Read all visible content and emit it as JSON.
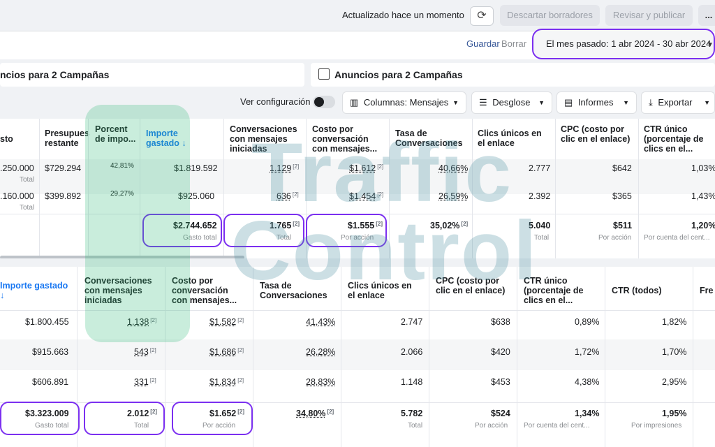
{
  "topbar": {
    "updated": "Actualizado hace un momento",
    "discard": "Descartar borradores",
    "review": "Revisar y publicar",
    "more": "..."
  },
  "bar2": {
    "save": "Guardar",
    "clear": "Borrar",
    "date_range": "El mes pasado: 1 abr 2024 - 30 abr 2024"
  },
  "tabs": {
    "left": "ncios para 2 Campañas",
    "right": "Anuncios para 2 Campañas"
  },
  "toolbar": {
    "config": "Ver configuración",
    "columns": "Columnas: Mensajes",
    "breakdown": "Desglose",
    "reports": "Informes",
    "export": "Exportar"
  },
  "table1": {
    "headers": [
      "sto",
      "Presupues restante",
      "Porcent de impo...",
      "Importe gastado ↓",
      "Conversaciones con mensajes iniciadas",
      "Costo por conversación con mensajes...",
      "Tasa de Conversaciones",
      "Clics únicos en el enlace",
      "CPC (costo por clic en el enlace)",
      "CTR único (porcentaje de clics en el..."
    ],
    "rows": [
      {
        "c0": ".250.000",
        "c0sub": "Total",
        "c1": "$729.294",
        "c2": "42,81%",
        "c3": "$1.819.592",
        "c4": "1.129",
        "c5": "$1.612",
        "c6": "40,66%",
        "c7": "2.777",
        "c8": "$642",
        "c9": "1,03%"
      },
      {
        "c0": ".160.000",
        "c0sub": "Total",
        "c1": "$399.892",
        "c2": "29,27%",
        "c3": "$925.060",
        "c4": "636",
        "c5": "$1.454",
        "c6": "26,59%",
        "c7": "2.392",
        "c8": "$365",
        "c9": "1,43%"
      }
    ],
    "total": {
      "c3": "$2.744.652",
      "c3sub": "Gasto total",
      "c4": "1.765",
      "c4sub": "Total",
      "c5": "$1.555",
      "c5sub": "Por acción",
      "c6": "35,02%",
      "c7": "5.040",
      "c7sub": "Total",
      "c8": "$511",
      "c8sub": "Por acción",
      "c9": "1,20%",
      "c9sub": "Por cuenta del cent..."
    }
  },
  "table2": {
    "headers": [
      "Importe gastado ↓",
      "Conversaciones con mensajes iniciadas",
      "Costo por conversación con mensajes...",
      "Tasa de Conversaciones",
      "Clics únicos en el enlace",
      "CPC (costo por clic en el enlace)",
      "CTR único (porcentaje de clics en el...",
      "CTR (todos)",
      "Fre"
    ],
    "rows": [
      {
        "c0": "$1.800.455",
        "c1": "1.138",
        "c2": "$1.582",
        "c3": "41,43%",
        "c4": "2.747",
        "c5": "$638",
        "c6": "0,89%",
        "c7": "1,82%"
      },
      {
        "c0": "$915.663",
        "c1": "543",
        "c2": "$1.686",
        "c3": "26,28%",
        "c4": "2.066",
        "c5": "$420",
        "c6": "1,72%",
        "c7": "1,70%"
      },
      {
        "c0": "$606.891",
        "c1": "331",
        "c2": "$1.834",
        "c3": "28,83%",
        "c4": "1.148",
        "c5": "$453",
        "c6": "4,38%",
        "c7": "2,95%"
      }
    ],
    "total": {
      "c0": "$3.323.009",
      "c0sub": "Gasto total",
      "c1": "2.012",
      "c1sub": "Total",
      "c2": "$1.652",
      "c2sub": "Por acción",
      "c3": "34,80%",
      "c4": "5.782",
      "c4sub": "Total",
      "c5": "$524",
      "c5sub": "Por acción",
      "c6": "1,34%",
      "c6sub": "Por cuenta del cent...",
      "c7": "1,95%",
      "c7sub": "Por impresiones"
    }
  },
  "superscript": "[2]",
  "watermark": {
    "line1": "Traffic",
    "line2": "Control"
  },
  "colors": {
    "highlight": "#7b2ff0",
    "link": "#385898",
    "watermark": "#27b673"
  }
}
